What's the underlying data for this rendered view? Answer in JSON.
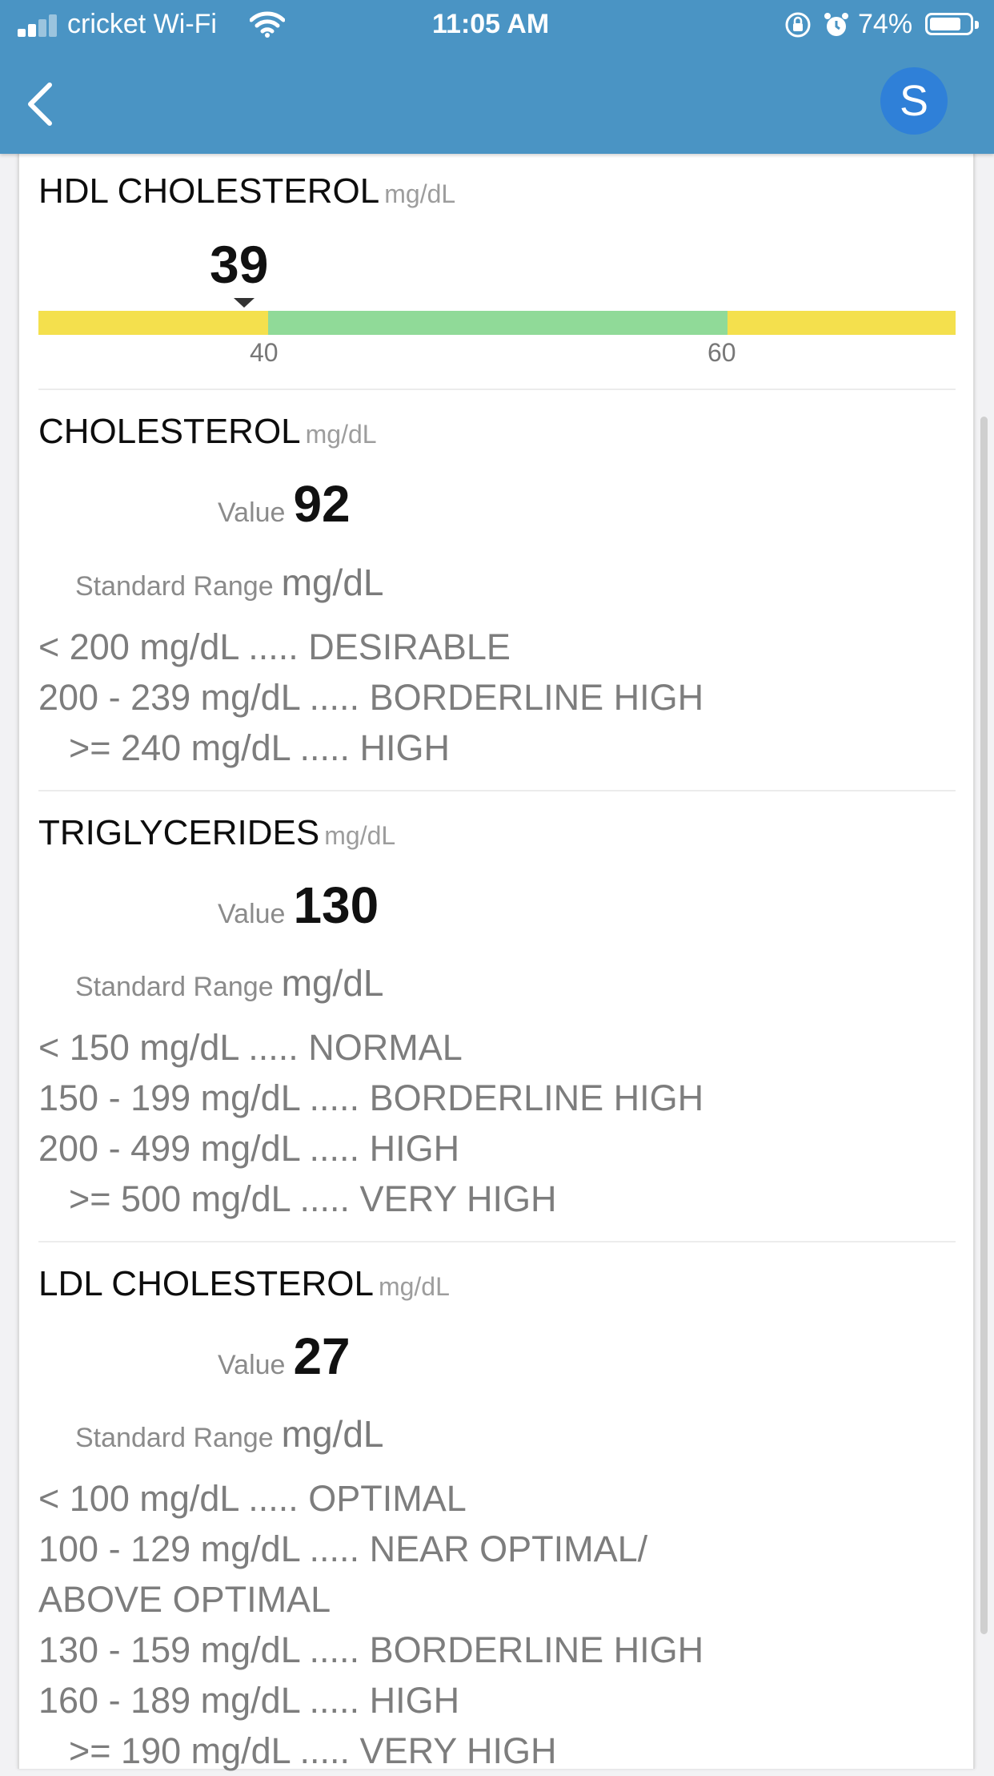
{
  "status_bar": {
    "carrier": "cricket Wi-Fi",
    "time": "11:05 AM",
    "battery": "74%",
    "battery_level": 0.74
  },
  "nav": {
    "back_icon": "chevron-left-icon",
    "avatar_letter": "S"
  },
  "colors": {
    "header": "#4a94c4",
    "gauge_yellow": "#f4e04d",
    "gauge_green": "#90da98",
    "avatar": "#2f80d8"
  },
  "hdl": {
    "title": "HDL CHOLESTEROL",
    "unit": "mg/dL",
    "value": "39",
    "ticks": [
      "40",
      "60"
    ]
  },
  "cholesterol": {
    "title": "CHOLESTEROL",
    "unit": "mg/dL",
    "value_label": "Value",
    "value": "92",
    "range_label": "Standard Range",
    "range_unit": "mg/dL",
    "ranges": [
      "< 200 mg/dL ..... DESIRABLE",
      "200 - 239 mg/dL ..... BORDERLINE HIGH",
      ">= 240 mg/dL ..... HIGH"
    ]
  },
  "triglycerides": {
    "title": "TRIGLYCERIDES",
    "unit": "mg/dL",
    "value_label": "Value",
    "value": "130",
    "range_label": "Standard Range",
    "range_unit": "mg/dL",
    "ranges": [
      "< 150 mg/dL ..... NORMAL",
      "150 - 199 mg/dL ..... BORDERLINE HIGH",
      "200 - 499 mg/dL ..... HIGH",
      ">= 500 mg/dL ..... VERY HIGH"
    ]
  },
  "ldl": {
    "title": "LDL CHOLESTEROL",
    "unit": "mg/dL",
    "value_label": "Value",
    "value": "27",
    "range_label": "Standard Range",
    "range_unit": "mg/dL",
    "ranges": [
      "< 100 mg/dL ..... OPTIMAL",
      "100 - 129 mg/dL ..... NEAR OPTIMAL/",
      "ABOVE OPTIMAL",
      "130 - 159 mg/dL ..... BORDERLINE HIGH",
      "160 - 189 mg/dL ..... HIGH",
      ">= 190 mg/dL ..... VERY HIGH"
    ]
  }
}
